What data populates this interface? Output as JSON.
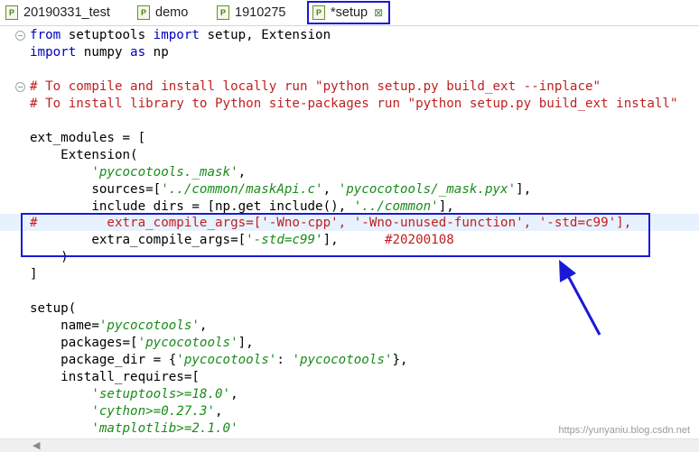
{
  "tabs": [
    {
      "label": "20190331_test",
      "icon": "python-file-icon"
    },
    {
      "label": "demo",
      "icon": "python-file-icon"
    },
    {
      "label": "1910275",
      "icon": "python-file-icon"
    },
    {
      "label": "*setup",
      "icon": "python-file-icon",
      "active": true,
      "close": "⊠"
    }
  ],
  "icon_letter": "P",
  "code": {
    "l1": {
      "a": "from",
      "b": " setuptools ",
      "c": "import",
      "d": " setup, Extension"
    },
    "l2": {
      "a": "import",
      "b": " numpy ",
      "c": "as",
      "d": " np"
    },
    "l4": "# To compile and install locally run \"python setup.py build_ext --inplace\"",
    "l5": "# To install library to Python site-packages run \"python setup.py build_ext install\"",
    "l7": "ext_modules = [",
    "l8": "    Extension(",
    "l9": {
      "indent": "        ",
      "s": "'pycocotools._mask'",
      "t": ","
    },
    "l10": {
      "a": "        sources=[",
      "s1": "'../common/maskApi.c'",
      "b": ", ",
      "s2": "'pycocotools/_mask.pyx'",
      "c": "],"
    },
    "l11": {
      "a": "        include_dirs = [np.get_include(), ",
      "s": "'../common'",
      "c": "],"
    },
    "l12": "#         extra_compile_args=['-Wno-cpp', '-Wno-unused-function', '-std=c99'],",
    "l13": {
      "a": "        extra_compile_args=[",
      "s": "'-std=c99'",
      "b": "],      ",
      "cm": "#20200108"
    },
    "l14": "    )",
    "l15": "]",
    "l17": "setup(",
    "l18": {
      "a": "    name=",
      "s": "'pycocotools'",
      "b": ","
    },
    "l19": {
      "a": "    packages=[",
      "s": "'pycocotools'",
      "b": "],"
    },
    "l20": {
      "a": "    package_dir = {",
      "s1": "'pycocotools'",
      "b": ": ",
      "s2": "'pycocotools'",
      "c": "},"
    },
    "l21": "    install_requires=[",
    "l22": {
      "indent": "        ",
      "s": "'setuptools>=18.0'",
      "b": ","
    },
    "l23": {
      "indent": "        ",
      "s": "'cython>=0.27.3'",
      "b": ","
    },
    "l24": {
      "indent": "        ",
      "s": "'matplotlib>=2.1.0'"
    }
  },
  "fold_symbol": "−",
  "scroll_left": "◀",
  "watermark": "https://yunyaniu.blog.csdn.net",
  "colors": {
    "highlight": "#1a1ad6",
    "keyword": "#0000c0",
    "comment": "#c02020",
    "string": "#1a8c1a"
  }
}
